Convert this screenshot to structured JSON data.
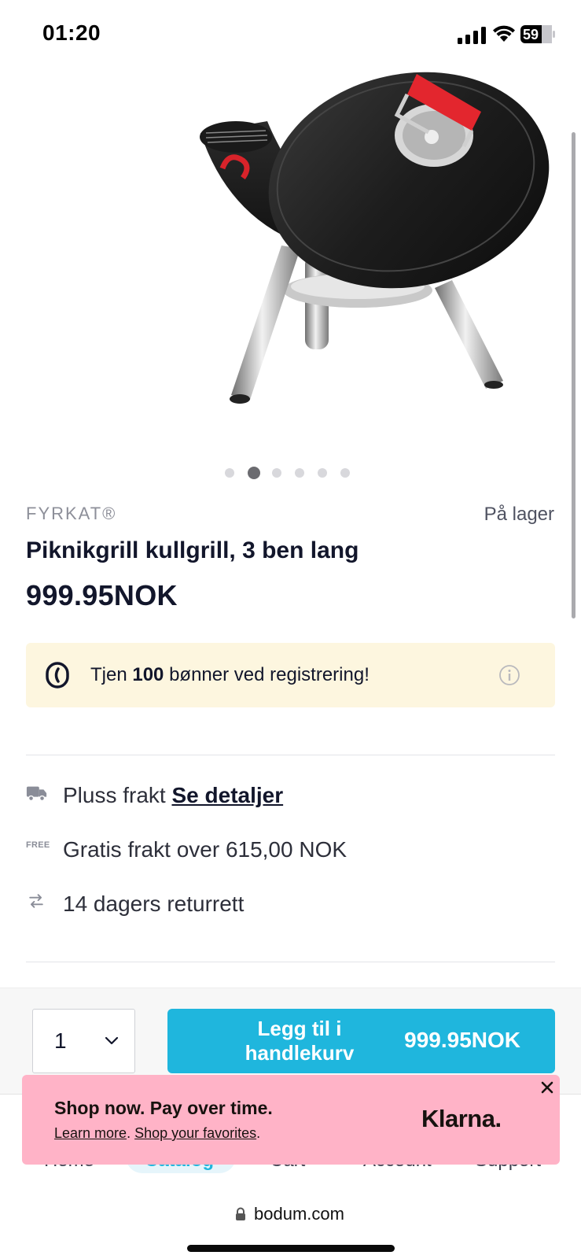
{
  "status_bar": {
    "time": "01:20",
    "battery": "59"
  },
  "product": {
    "brand": "FYRKAT®",
    "stock": "På lager",
    "title": "Piknikgrill kullgrill, 3 ben lang",
    "price": "999.95NOK",
    "image_alt": "Piknikgrill kullgrill",
    "carousel": {
      "count": 6,
      "active_index": 1
    }
  },
  "rewards": {
    "prefix": "Tjen ",
    "amount": "100",
    "suffix": " bønner ved registrering!"
  },
  "features": {
    "shipping": {
      "text": "Pluss frakt ",
      "link": "Se detaljer"
    },
    "free_shipping": {
      "icon_label": "FREE",
      "text": "Gratis frakt over  615,00 NOK"
    },
    "returns": {
      "text": "14 dagers returrett"
    }
  },
  "cart": {
    "quantity": "1",
    "button_label": "Legg til i handlekurv",
    "button_price": "999.95NOK"
  },
  "tab_bar": {
    "items": [
      "Home",
      "Catalog",
      "Cart",
      "Account",
      "Support"
    ],
    "active": "Catalog"
  },
  "klarna": {
    "heading": "Shop now. Pay over time.",
    "learn_more": "Learn more",
    "shop_favorites": "Shop your favorites",
    "logo": "Klarna."
  },
  "browser": {
    "url": "bodum.com"
  },
  "colors": {
    "accent": "#1fb6dd",
    "klarna_pink": "#ffb3c7",
    "banner_bg": "#fdf6df",
    "text_dark": "#12162b"
  }
}
